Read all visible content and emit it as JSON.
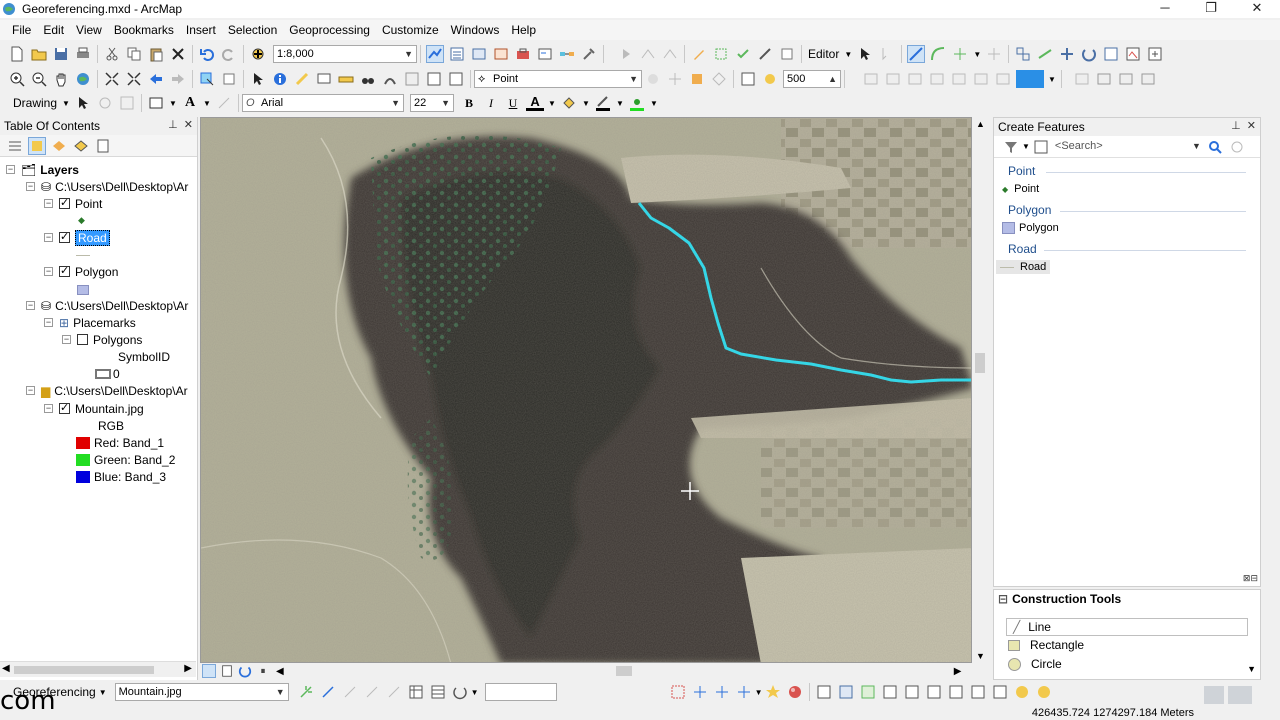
{
  "window": {
    "title": "Georeferencing.mxd - ArcMap",
    "minimize": "─",
    "restore": "❐",
    "close": "✕"
  },
  "menu": [
    "File",
    "Edit",
    "View",
    "Bookmarks",
    "Insert",
    "Selection",
    "Geoprocessing",
    "Customize",
    "Windows",
    "Help"
  ],
  "toolbar": {
    "scale": "1:8,000",
    "editor_label": "Editor",
    "layer_combo": "Point",
    "snap_value": "500",
    "drawing_label": "Drawing",
    "font_name": "Arial",
    "font_size": "22",
    "bold": "B",
    "italic": "I",
    "underline": "U",
    "font_color_letter": "A"
  },
  "toc": {
    "title": "Table Of Contents",
    "pin": "📌",
    "close": "✕",
    "root": "Layers",
    "items": [
      {
        "label": "C:\\Users\\Dell\\Desktop\\Ar"
      },
      {
        "label": "Point"
      },
      {
        "label": "Road"
      },
      {
        "label": "Polygon"
      },
      {
        "label": "C:\\Users\\Dell\\Desktop\\Ar"
      },
      {
        "label": "Placemarks"
      },
      {
        "label": "Polygons"
      },
      {
        "label": "SymbolID"
      },
      {
        "label": "0"
      },
      {
        "label": "C:\\Users\\Dell\\Desktop\\Ar"
      },
      {
        "label": "Mountain.jpg"
      },
      {
        "label": "RGB"
      },
      {
        "label": "Red:   Band_1"
      },
      {
        "label": "Green: Band_2"
      },
      {
        "label": "Blue:  Band_3"
      }
    ],
    "colors": {
      "red": "#e00000",
      "green": "#22dd22",
      "blue": "#0000dd",
      "polygon": "#b4bce6"
    }
  },
  "create_features": {
    "title": "Create Features",
    "search_placeholder": "<Search>",
    "groups": [
      {
        "name": "Point",
        "item": "Point"
      },
      {
        "name": "Polygon",
        "item": "Polygon"
      },
      {
        "name": "Road",
        "item": "Road"
      }
    ]
  },
  "construction_tools": {
    "title": "Construction Tools",
    "items": [
      "Line",
      "Rectangle",
      "Circle"
    ]
  },
  "bottom": {
    "georef_label": "Georeferencing",
    "raster_combo": "Mountain.jpg"
  },
  "status": {
    "coords": "426435.724  1274297.184 Meters",
    "watermark": "com"
  },
  "map": {
    "road_color": "#35d6e6"
  }
}
